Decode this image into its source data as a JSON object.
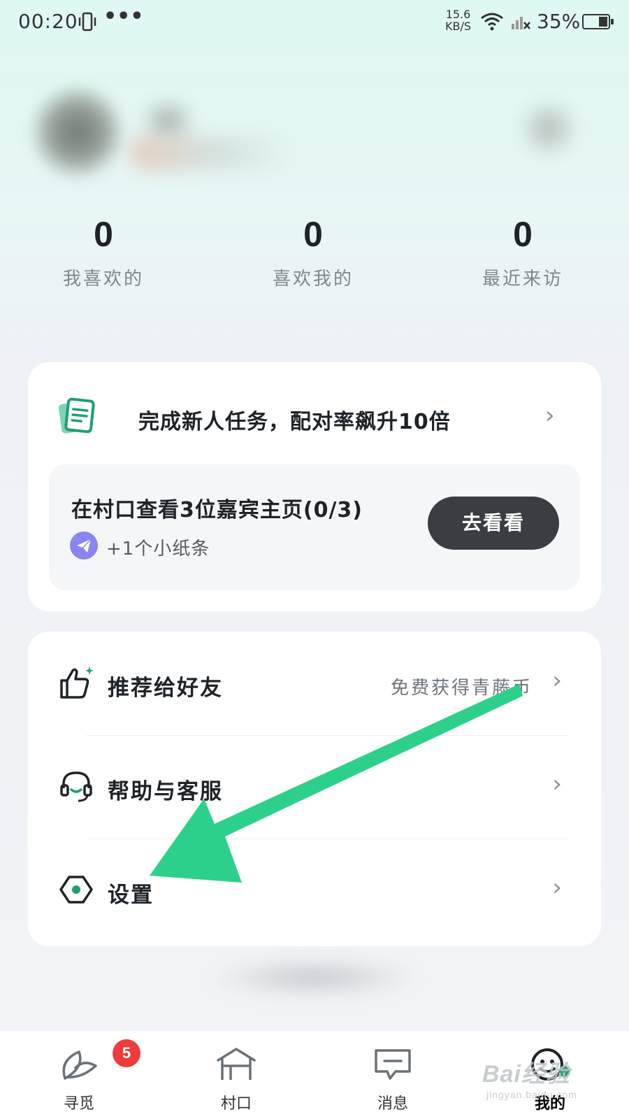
{
  "status_bar": {
    "time": "00:20",
    "more": "•••",
    "net_speed_value": "15.6",
    "net_speed_unit": "KB/S",
    "battery": "35%"
  },
  "stats": [
    {
      "value": "0",
      "label": "我喜欢的"
    },
    {
      "value": "0",
      "label": "喜欢我的"
    },
    {
      "value": "0",
      "label": "最近来访"
    }
  ],
  "task_card": {
    "title": "完成新人任务，配对率飙升10倍",
    "subtask_title": "在村口查看3位嘉宾主页(0/3)",
    "reward": "+1个小纸条",
    "button": "去看看"
  },
  "menu": {
    "recommend": {
      "label": "推荐给好友",
      "extra": "免费获得青藤币"
    },
    "help": {
      "label": "帮助与客服"
    },
    "settings": {
      "label": "设置"
    }
  },
  "tabs": [
    {
      "label": "寻觅",
      "badge": "5",
      "icon": "leaf-icon"
    },
    {
      "label": "村口",
      "icon": "village-gate-icon"
    },
    {
      "label": "消息",
      "icon": "message-icon"
    },
    {
      "label": "我的",
      "icon": "face-icon",
      "active": true
    }
  ],
  "watermark": {
    "brand": "Bai经验",
    "url": "jingyan.baidu.com"
  },
  "colors": {
    "accent": "#1f9e76",
    "arrow": "#2dd08a",
    "badge": "#ef3b3b",
    "button": "#3a3d42"
  }
}
